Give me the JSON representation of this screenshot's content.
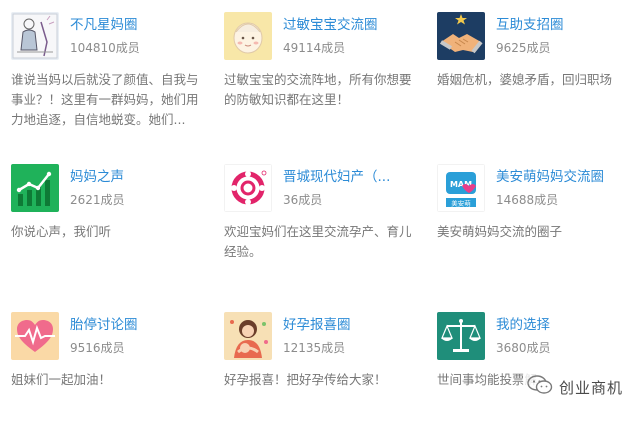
{
  "groups": [
    {
      "name": "不凡星妈圈",
      "count": "104810成员",
      "desc": "谁说当妈以后就没了颜值、自我与事业？！这里有一群妈妈，她们用力地追逐，自信地蜕变。她们...",
      "icon": "mother-sketch-icon"
    },
    {
      "name": "过敏宝宝交流圈",
      "count": "49114成员",
      "desc": "过敏宝宝的交流阵地，所有你想要的防敏知识都在这里！",
      "icon": "baby-face-icon"
    },
    {
      "name": "互助支招圈",
      "count": "9625成员",
      "desc": "婚姻危机，婆媳矛盾，回归职场",
      "icon": "handshake-icon"
    },
    {
      "name": "妈妈之声",
      "count": "2621成员",
      "desc": "你说心声，我们听",
      "icon": "growth-chart-icon"
    },
    {
      "name": "晋城现代妇产（...",
      "count": "36成员",
      "desc": "欢迎宝妈们在这里交流孕产、育儿经验。",
      "icon": "hospital-logo-icon"
    },
    {
      "name": "美安萌妈妈交流圈",
      "count": "14688成员",
      "desc": "美安萌妈妈交流的圈子",
      "icon": "mam-logo-icon",
      "icon_text_1": "MAM",
      "icon_text_2": "美安萌"
    },
    {
      "name": "胎停讨论圈",
      "count": "9516成员",
      "desc": "姐妹们一起加油！",
      "icon": "heartbeat-icon"
    },
    {
      "name": "好孕报喜圈",
      "count": "12135成员",
      "desc": "好孕报喜！把好孕传给大家！",
      "icon": "mother-baby-icon"
    },
    {
      "name": "我的选择",
      "count": "3680成员",
      "desc": "世间事均能投票解",
      "icon": "scales-icon"
    }
  ],
  "watermark": {
    "text": "创业商机",
    "icon": "wechat-icon"
  },
  "colors": {
    "link": "#2c8bd6",
    "muted": "#8c8c8c",
    "desc": "#777777"
  }
}
